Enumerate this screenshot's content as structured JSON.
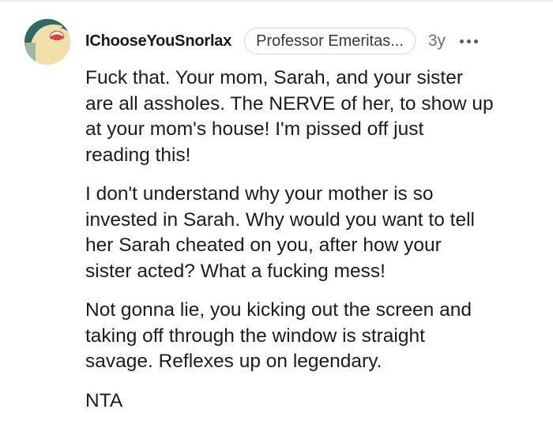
{
  "comment": {
    "username": "IChooseYouSnorlax",
    "flair": "Professor Emeritas...",
    "age": "3y",
    "avatar_icon": "snorlax-avatar-icon",
    "more_icon": "more-options-icon",
    "paragraphs": [
      "Fuck that. Your mom, Sarah, and your sister\nare all assholes. The NERVE of her, to show up\nat your mom's house! I'm pissed off just\nreading this!",
      "I don't understand why your mother is so\ninvested in Sarah. Why would you want to tell\nher Sarah cheated on you, after how your\nsister acted? What a fucking mess!",
      "Not gonna lie, you kicking out the screen and\ntaking off through the window is straight\nsavage. Reflexes up on legendary.",
      "NTA"
    ]
  },
  "colors": {
    "avatar_background": "#f0dfa8",
    "avatar_body": "#2f6a66",
    "avatar_mouth": "#d9443f",
    "text": "#1c1c1c",
    "meta_text": "#6f6f6f",
    "flair_border": "#d6d6d6"
  }
}
